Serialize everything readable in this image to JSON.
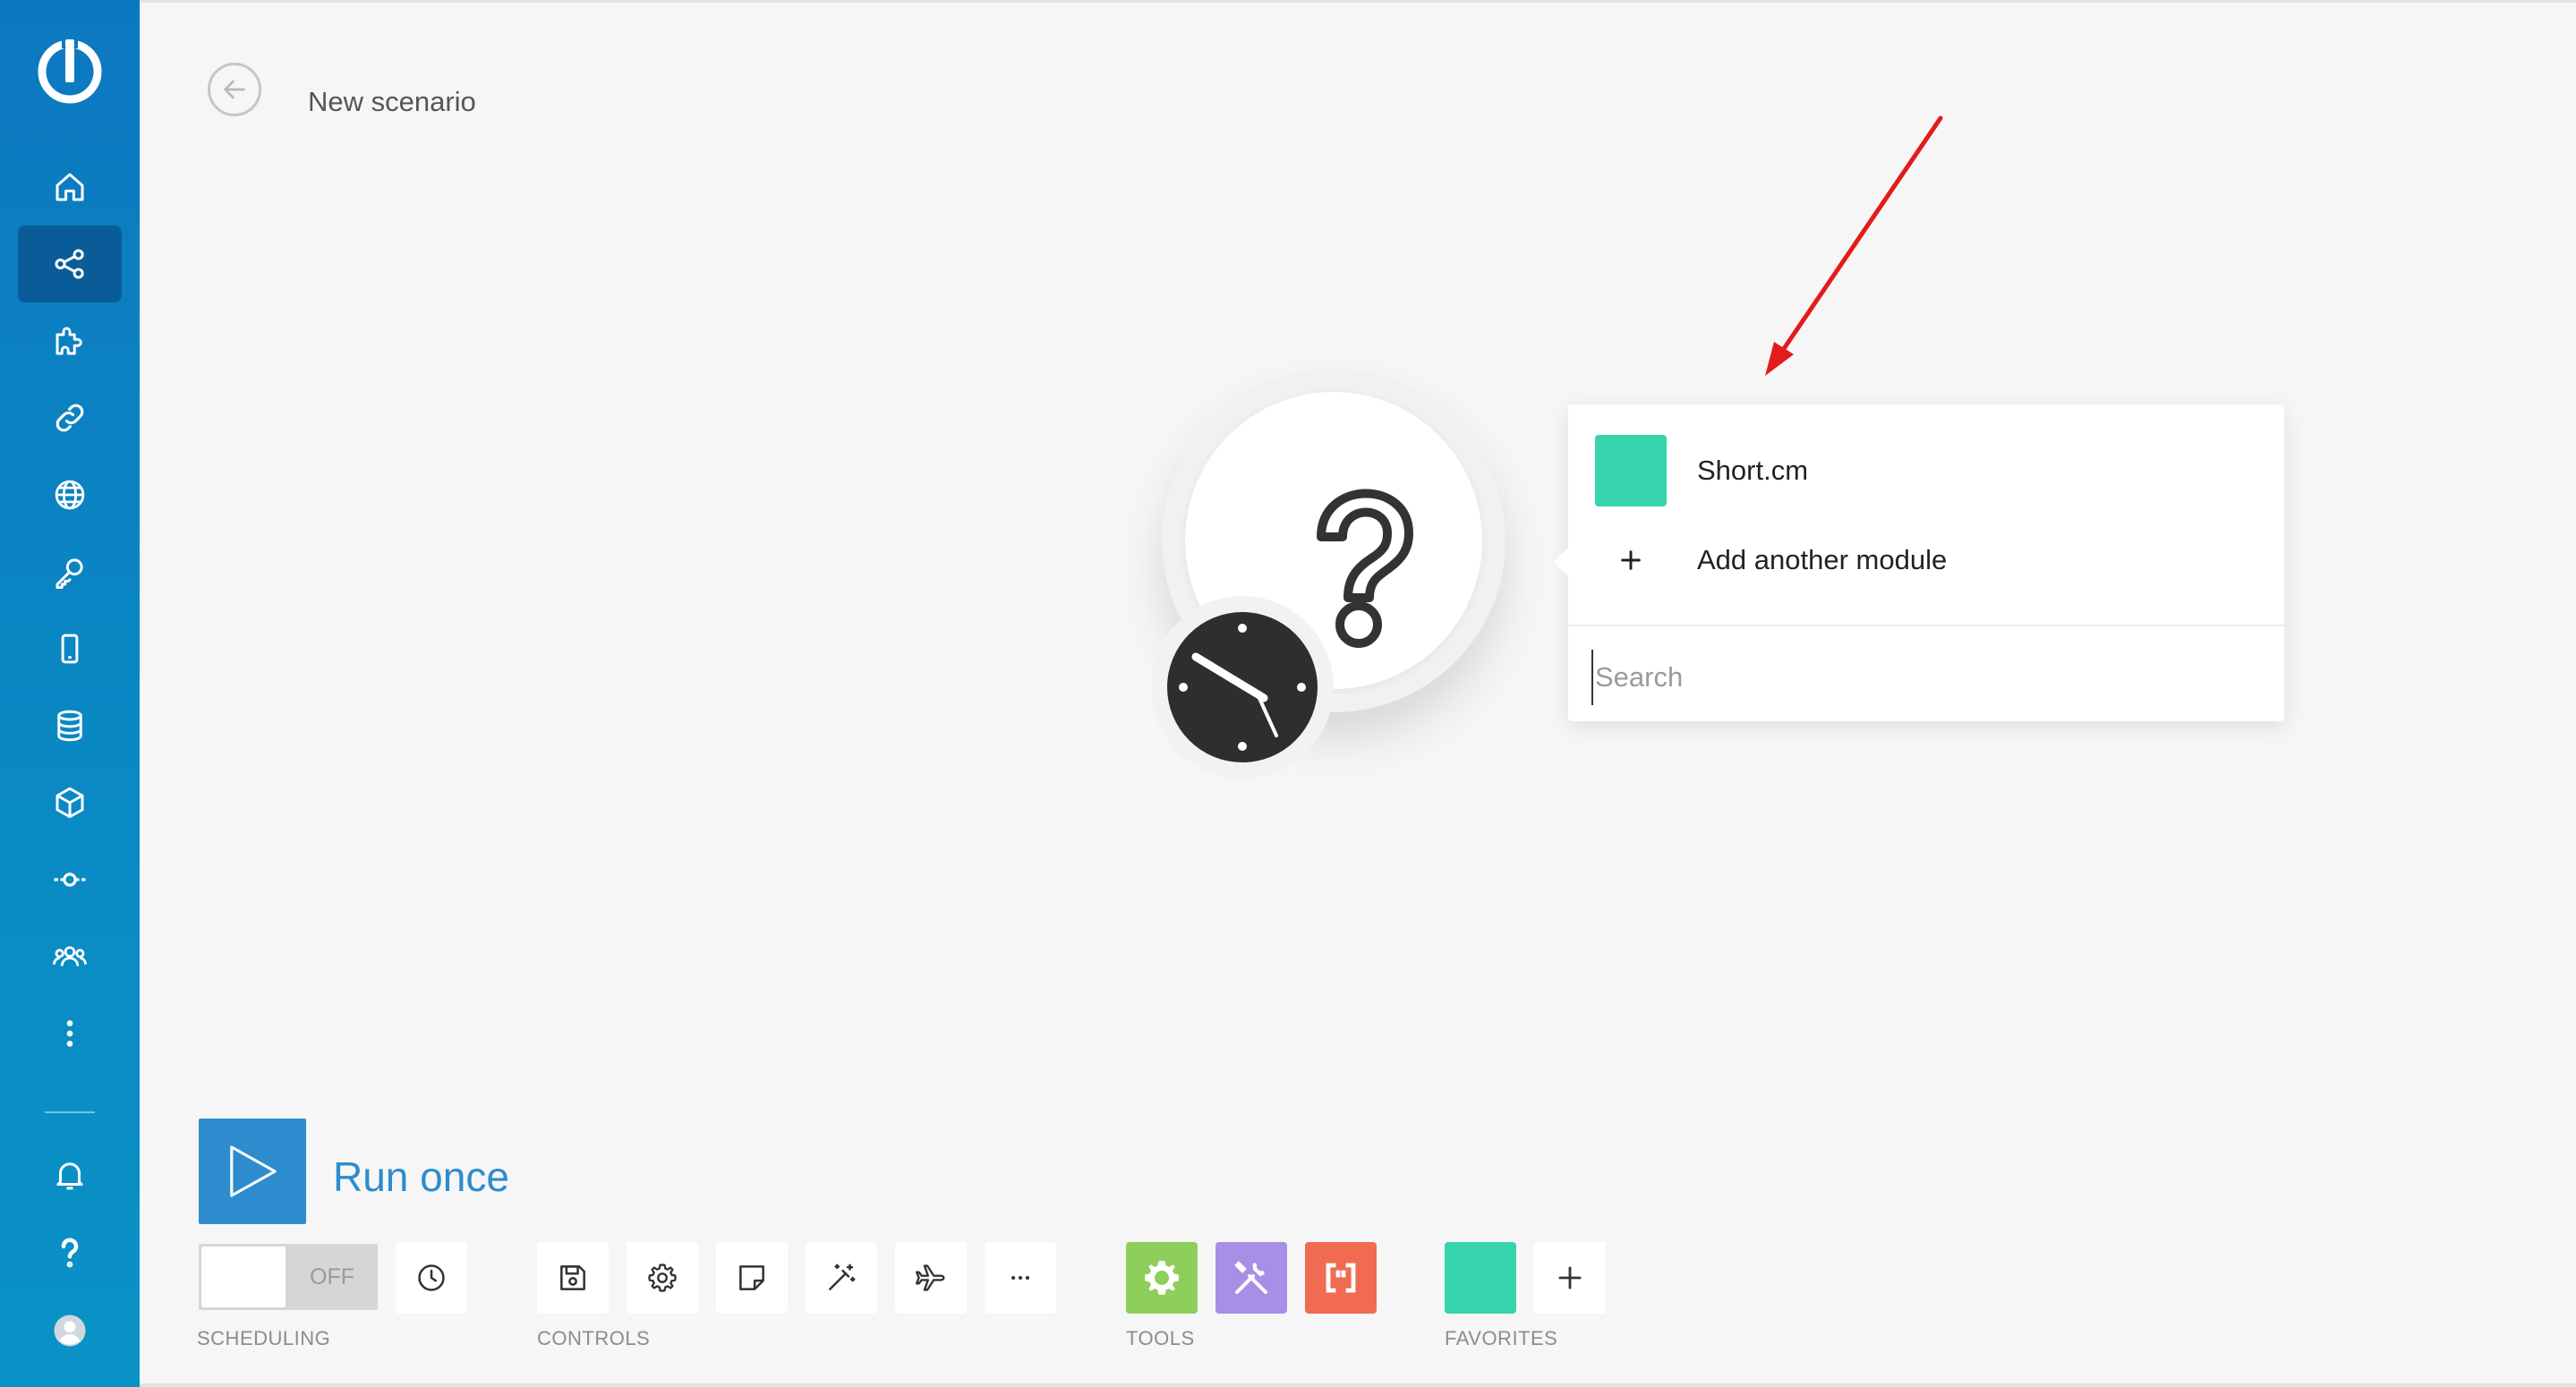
{
  "header": {
    "title": "New scenario"
  },
  "sidebar": {
    "items": [
      {
        "name": "home",
        "icon": "home-icon",
        "active": false
      },
      {
        "name": "scenarios",
        "icon": "share-nodes-icon",
        "active": true
      },
      {
        "name": "templates",
        "icon": "puzzle-icon",
        "active": false
      },
      {
        "name": "connections",
        "icon": "link-icon",
        "active": false
      },
      {
        "name": "webhooks",
        "icon": "globe-icon",
        "active": false
      },
      {
        "name": "keys",
        "icon": "key-icon",
        "active": false
      },
      {
        "name": "devices",
        "icon": "mobile-icon",
        "active": false
      },
      {
        "name": "data-stores",
        "icon": "database-icon",
        "active": false
      },
      {
        "name": "data-structures",
        "icon": "cube-icon",
        "active": false
      },
      {
        "name": "flow",
        "icon": "commit-icon",
        "active": false
      },
      {
        "name": "team",
        "icon": "users-icon",
        "active": false
      },
      {
        "name": "more",
        "icon": "more-vertical-icon",
        "active": false
      },
      {
        "name": "notifications",
        "icon": "bell-icon",
        "active": false
      },
      {
        "name": "help",
        "icon": "question-icon",
        "active": false
      },
      {
        "name": "profile",
        "icon": "avatar-icon",
        "active": false
      }
    ]
  },
  "module_popup": {
    "app_label": "Short.cm",
    "app_color": "#36d4ac",
    "add_label": "Add another module",
    "search_placeholder": "Search"
  },
  "run": {
    "label": "Run once"
  },
  "scheduling": {
    "toggle_state": "OFF",
    "label": "SCHEDULING"
  },
  "controls": {
    "label": "CONTROLS",
    "buttons": [
      "save",
      "settings",
      "notes",
      "auto-align",
      "explain-flow",
      "more"
    ]
  },
  "tools": {
    "label": "TOOLS",
    "items": [
      {
        "name": "flow-control",
        "color": "#8dcf5a"
      },
      {
        "name": "tools",
        "color": "#a78ee6"
      },
      {
        "name": "text-parser",
        "color": "#f06b52"
      }
    ]
  },
  "favorites": {
    "label": "FAVORITES",
    "tile_color": "#36d4ac"
  },
  "colors": {
    "sidebar": "#0a86c4",
    "accent": "#2d8ccd",
    "arrow": "#e31b1b"
  }
}
